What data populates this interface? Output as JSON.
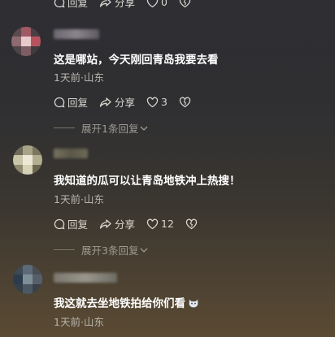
{
  "top_partial": {
    "reply_label": "回复",
    "share_label": "分享",
    "like_count": "0"
  },
  "comments": [
    {
      "text": "这是哪站，今天刚回青岛我要去看",
      "time": "1天前",
      "location": "山东",
      "reply_label": "回复",
      "share_label": "分享",
      "like_count": "3",
      "expand_label": "展开1条回复"
    },
    {
      "text": "我知道的瓜可以让青岛地铁冲上热搜！",
      "time": "1天前",
      "location": "山东",
      "reply_label": "回复",
      "share_label": "分享",
      "like_count": "12",
      "expand_label": "展开3条回复"
    },
    {
      "text": "我这就去坐地铁拍给你们看",
      "time": "1天前",
      "location": "山东"
    }
  ],
  "icons": {
    "reply": "speech-bubble-icon",
    "share": "share-arrow-icon",
    "like": "heart-icon",
    "dislike": "broken-heart-icon",
    "expand": "chevron-down-icon",
    "emoji": "cat-face-emoji"
  }
}
